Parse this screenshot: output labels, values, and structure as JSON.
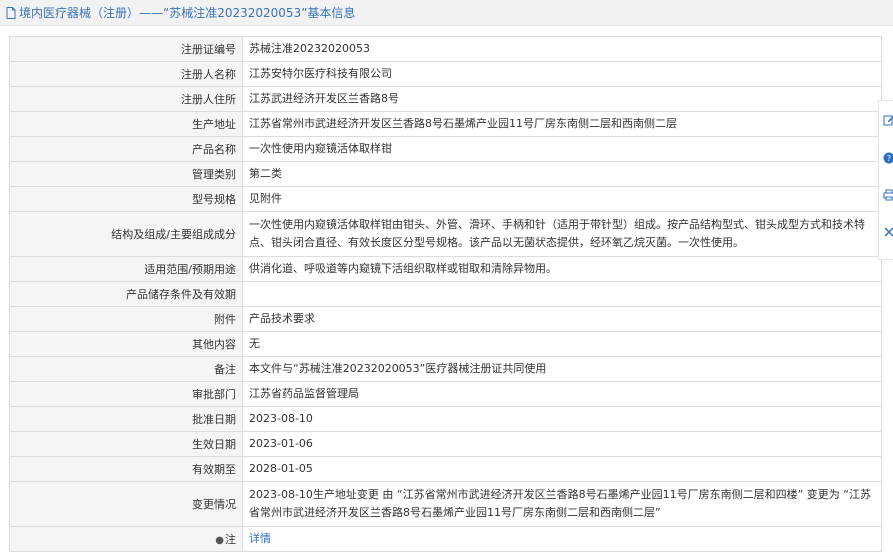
{
  "header": {
    "title": "境内医疗器械（注册）——“苏械注准20232020053”基本信息",
    "icon": "document-icon"
  },
  "rows": [
    {
      "label": "注册证编号",
      "value": "苏械注准20232020053"
    },
    {
      "label": "注册人名称",
      "value": "江苏安特尔医疗科技有限公司"
    },
    {
      "label": "注册人住所",
      "value": "江苏武进经济开发区兰香路8号"
    },
    {
      "label": "生产地址",
      "value": "江苏省常州市武进经济开发区兰香路8号石墨烯产业园11号厂房东南侧二层和西南侧二层"
    },
    {
      "label": "产品名称",
      "value": "一次性使用内窥镜活体取样钳"
    },
    {
      "label": "管理类别",
      "value": "第二类"
    },
    {
      "label": "型号规格",
      "value": "见附件"
    },
    {
      "label": "结构及组成/主要组成成分",
      "value": "一次性使用内窥镜活体取样钳由钳头、外管、滑环、手柄和针（适用于带针型）组成。按产品结构型式、钳头成型方式和技术特点、钳头闭合直径、有效长度区分型号规格。该产品以无菌状态提供，经环氧乙烷灭菌。一次性使用。"
    },
    {
      "label": "适用范围/预期用途",
      "value": "供消化道、呼吸道等内窥镜下活组织取样或钳取和清除异物用。"
    },
    {
      "label": "产品储存条件及有效期",
      "value": ""
    },
    {
      "label": "附件",
      "value": "产品技术要求"
    },
    {
      "label": "其他内容",
      "value": "无"
    },
    {
      "label": "备注",
      "value": "本文件与“苏械注准20232020053”医疗器械注册证共同使用"
    },
    {
      "label": "审批部门",
      "value": "江苏省药品监督管理局"
    },
    {
      "label": "批准日期",
      "value": "2023-08-10"
    },
    {
      "label": "生效日期",
      "value": "2023-01-06"
    },
    {
      "label": "有效期至",
      "value": "2028-01-05"
    },
    {
      "label": "变更情况",
      "value": "2023-08-10生产地址变更 由 “江苏省常州市武进经济开发区兰香路8号石墨烯产业园11号厂房东南侧二层和四楼” 变更为 “江苏省常州市武进经济开发区兰香路8号石墨烯产业园11号厂房东南侧二层和西南侧二层”"
    }
  ],
  "note": {
    "label": "注",
    "link": "详情",
    "icon": "location-pin-icon"
  },
  "side_tools": [
    {
      "icon": "edit-icon"
    },
    {
      "icon": "help-icon"
    },
    {
      "icon": "print-icon"
    },
    {
      "icon": "close-icon"
    }
  ],
  "colors": {
    "link": "#2f6fbf",
    "label_bg": "#f5f5f5",
    "border": "#dcdcdc"
  }
}
